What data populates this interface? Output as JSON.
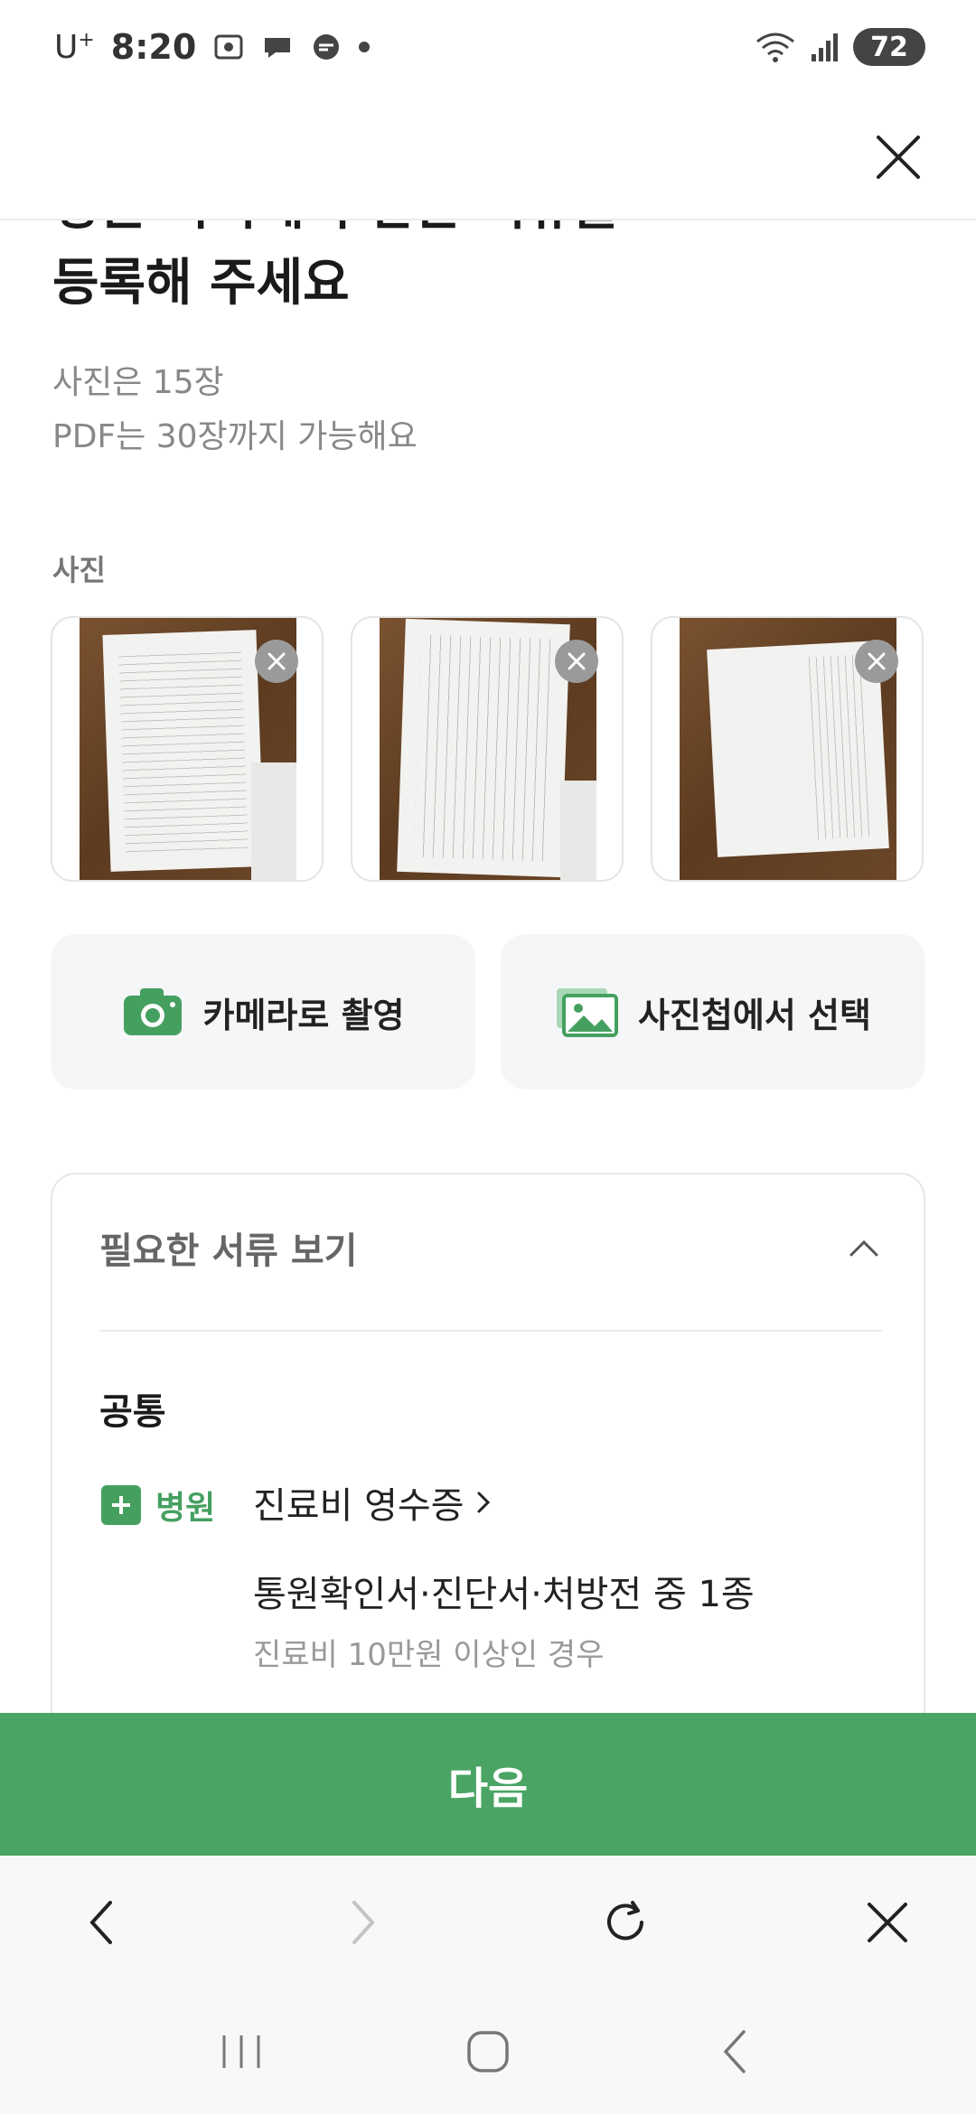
{
  "status_bar": {
    "carrier": "U",
    "carrier_sup": "+",
    "time": "8:20",
    "battery": "72"
  },
  "page": {
    "title_line1": "병원·약국에서 받은 서류를",
    "title_line2": "등록해 주세요",
    "subtitle_line1": "사진은 15장",
    "subtitle_line2": "PDF는 30장까지 가능해요",
    "photos_label": "사진"
  },
  "actions": {
    "camera_label": "카메라로 촬영",
    "gallery_label": "사진첩에서 선택"
  },
  "docs": {
    "header": "필요한 서류 보기",
    "category": "공통",
    "tag": "병원",
    "item_link": "진료비 영수증",
    "item_2": "통원확인서·진단서·처방전 중 1종",
    "item_2_note": "진료비 10만원 이상인 경우"
  },
  "next_button": "다음",
  "colors": {
    "accent": "#4aa564",
    "muted_text": "#888888",
    "card_bg": "#f5f6f8"
  }
}
